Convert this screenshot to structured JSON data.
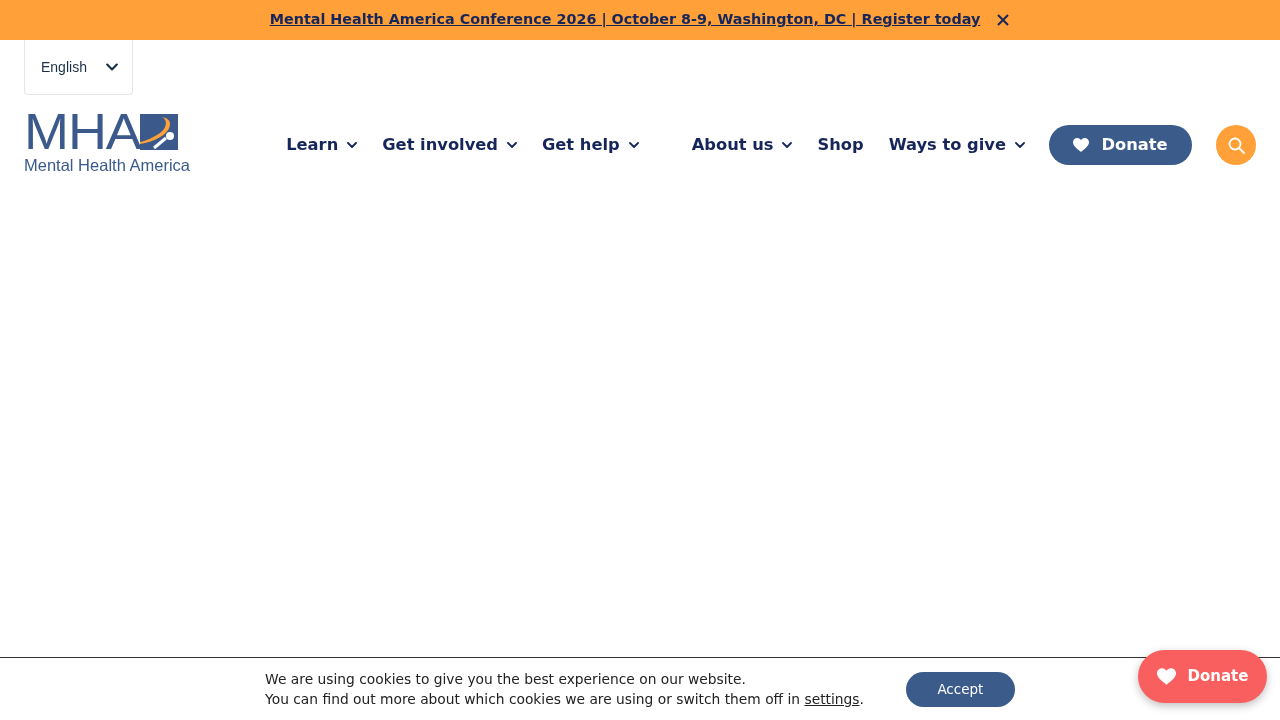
{
  "announcement": {
    "link": "Mental Health America Conference 2026 | October 8-9, Washington, DC | Register today"
  },
  "language_select": {
    "value": "English"
  },
  "logo": {
    "letters": "MHA",
    "tagline": "Mental Health America"
  },
  "nav": [
    {
      "label": "Learn",
      "has_menu": true
    },
    {
      "label": "Get involved",
      "has_menu": true
    },
    {
      "label": "Get help",
      "has_menu": true
    },
    {
      "label": "About us",
      "has_menu": true
    },
    {
      "label": "Shop",
      "has_menu": false
    },
    {
      "label": "Ways to give",
      "has_menu": true
    }
  ],
  "donate_button": {
    "label": "Donate"
  },
  "cookie_notice": {
    "line_1": "We are using cookies to give you the best experience on our website.",
    "line_2_before": "You can find out more about which cookies we are using or switch them off in ",
    "link": "settings",
    "line_2_after": ".",
    "accept": "Accept"
  },
  "floating_donate": {
    "label": "Donate"
  }
}
